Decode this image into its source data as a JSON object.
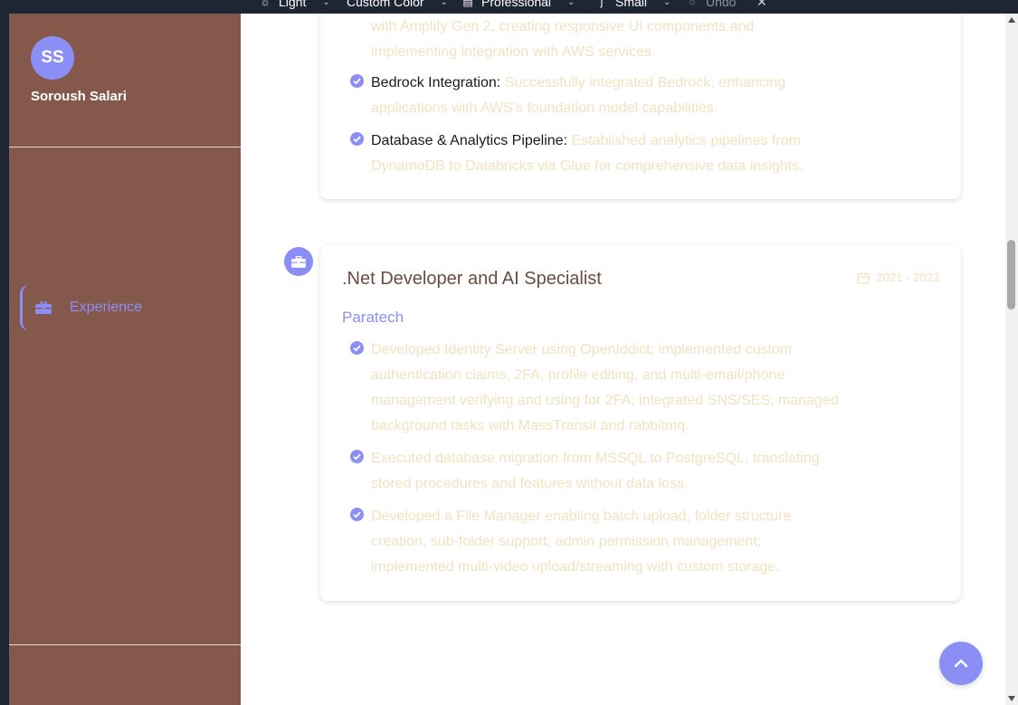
{
  "toolbar": {
    "theme_label": "Light",
    "color_label": "Custom Color",
    "style_label": "Professional",
    "size_label": "Small",
    "undo_label": "Undo"
  },
  "sidebar": {
    "initials": "SS",
    "name": "Soroush Salari",
    "nav": [
      {
        "label": "Experience",
        "icon": "briefcase-icon",
        "active": true
      }
    ]
  },
  "experience": {
    "prev_card": {
      "partial_text": "with Amplify Gen 2, creating responsive UI components and implementing integration with AWS services.",
      "bullets": [
        {
          "title": "Bedrock Integration:",
          "text": " Successfully integrated Bedrock, enhancing applications with AWS's foundation model capabilities."
        },
        {
          "title": "Database & Analytics Pipeline:",
          "text": " Established analytics pipelines from DynamoDB to Databricks via Glue for comprehensive data insights."
        }
      ]
    },
    "job": {
      "title": ".Net Developer and AI Specialist",
      "dates": "2021 - 2023",
      "company": "Paratech",
      "bullets": [
        "Developed Identity Server using OpenIddict; implemented custom authentication claims, 2FA, profile editing, and multi-email/phone management verifying and using for 2FA; integrated SNS/SES; managed background tasks with MassTransit and rabbitmq.",
        "Executed database migration from MSSQL to PostgreSQL, translating stored procedures and features without data loss.",
        "Developed a File Manager enabling batch upload, folder structure creation, sub-folder support, admin permission management; implemented multi-video upload/streaming with custom storage."
      ]
    }
  },
  "colors": {
    "accent": "#8b8ff5",
    "sidebar_bg": "#85584c",
    "muted_text": "#f2e2c0",
    "title_text": "#6b4b40"
  }
}
